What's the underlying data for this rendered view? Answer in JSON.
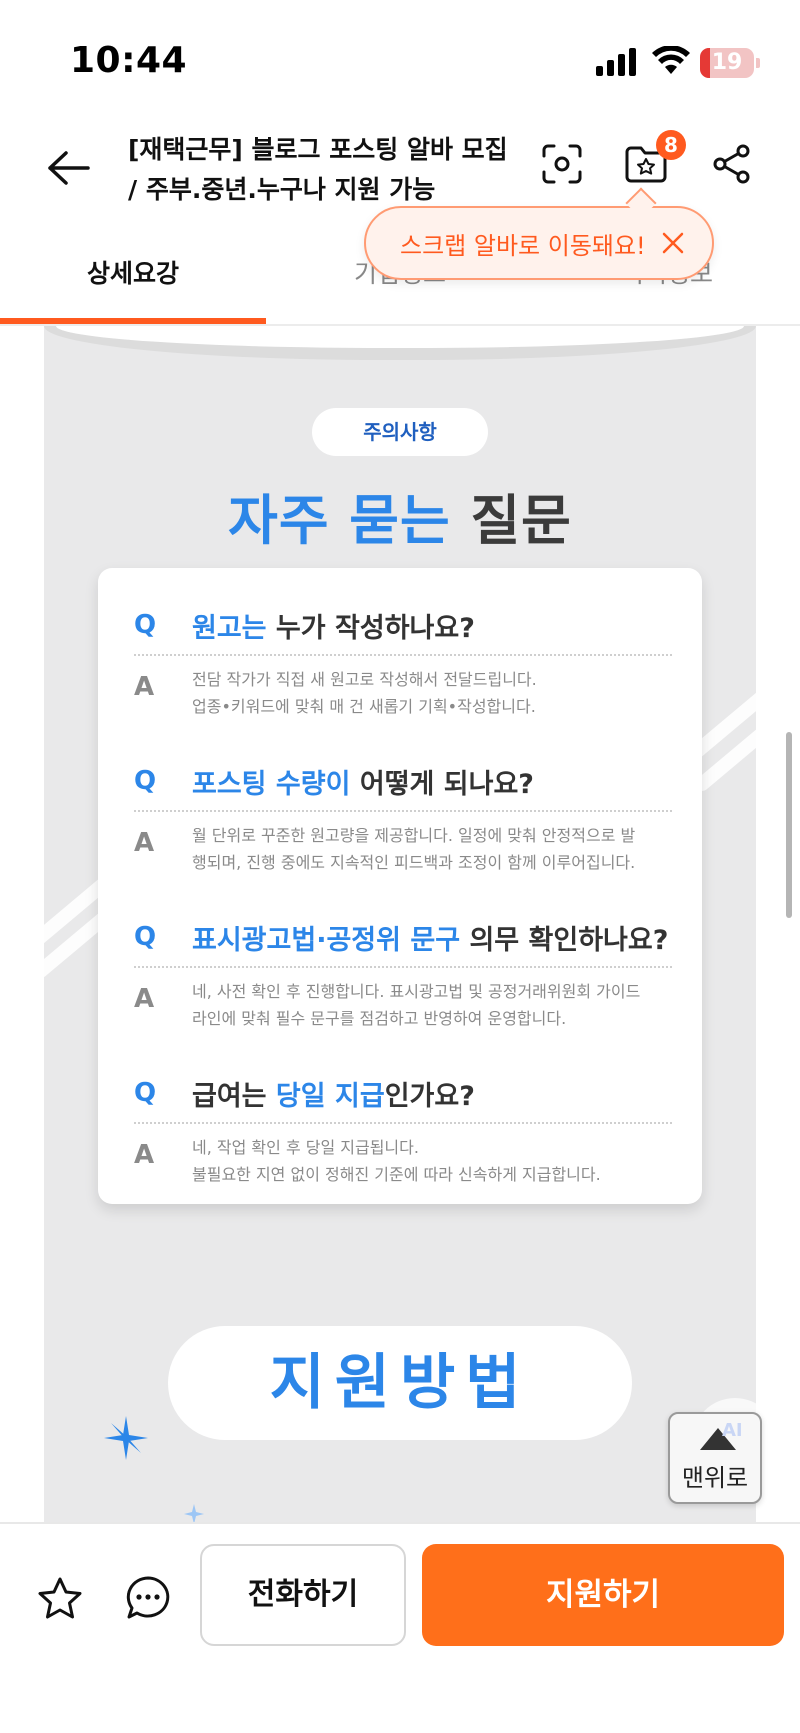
{
  "status_bar": {
    "time": "10:44",
    "battery_level": "19",
    "battery_fraction": 0.19,
    "battery_color": "#e53935",
    "icons": [
      "signal-icon",
      "wifi-icon",
      "battery-icon"
    ]
  },
  "header": {
    "title_line1": "[재택근무] 블로그 포스팅 알바 모집",
    "title_line2": "/ 주부.중년.누구나 지원 가능",
    "scrap_count": "8",
    "icons": [
      "back-arrow-icon",
      "scan-icon",
      "scrap-folder-icon",
      "share-icon"
    ]
  },
  "tooltip": {
    "text": "스크랩 알바로 이동돼요!",
    "accent": "#ff5a1f"
  },
  "tabs": [
    {
      "label": "상세요강",
      "active": true
    },
    {
      "label": "기업정보",
      "active": false
    },
    {
      "label": "지역정보",
      "active": false
    }
  ],
  "content": {
    "notice_label": "주의사항",
    "faq_title_blue": "자주 묻는",
    "faq_title_dark": "질문",
    "q_mark": "Q",
    "a_mark": "A",
    "faq": [
      {
        "q_hl": "원고는",
        "q_rest": " 누가 작성하나요?",
        "a_line1": "전담 작가가 직접 새 원고로 작성해서 전달드립니다.",
        "a_line2": "업종•키워드에 맞춰 매 건 새롭기 기획•작성합니다."
      },
      {
        "q_hl": "포스팅 수량이",
        "q_rest": " 어떻게 되나요?",
        "a_line1": "월 단위로 꾸준한 원고량을 제공합니다. 일정에 맞춰 안정적으로 발",
        "a_line2": "행되며, 진행 중에도 지속적인 피드백과 조정이 함께 이루어집니다."
      },
      {
        "q_hl": "표시광고법·공정위 문구",
        "q_rest": " 의무 확인하나요?",
        "a_line1": "네, 사전 확인 후 진행합니다. 표시광고법 및 공정거래위원회 가이드",
        "a_line2": "라인에 맞춰 필수 문구를 점검하고 반영하여 운영합니다."
      },
      {
        "q_pre": "급여는 ",
        "q_hl": "당일 지급",
        "q_rest": "인가요?",
        "a_line1": "네, 작업 확인 후 당일 지급됩니다.",
        "a_line2": "불필요한 지연 없이 정해진 기준에 따라 신속하게 지급합니다."
      }
    ],
    "apply_method_title": "지원방법",
    "brand_blue": "#2c86e8"
  },
  "floating": {
    "top_label": "맨위로",
    "ai_tag": "AI"
  },
  "bottom_bar": {
    "call_label": "전화하기",
    "apply_label": "지원하기",
    "apply_color": "#ff6f1a",
    "icons": [
      "star-icon",
      "chat-icon"
    ]
  }
}
